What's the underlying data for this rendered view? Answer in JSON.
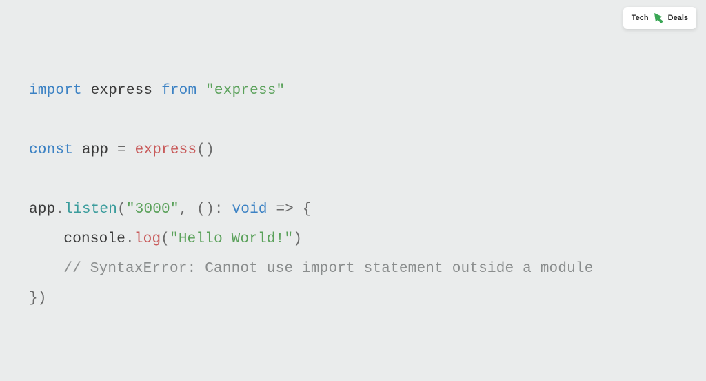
{
  "logo": {
    "text_left": "Tech",
    "text_right": "Deals"
  },
  "code": {
    "l1": {
      "import": "import",
      "express": "express",
      "from": "from",
      "str": "\"express\""
    },
    "l2": {
      "const": "const",
      "app": "app",
      "eq": " = ",
      "express_call": "express",
      "parens": "()"
    },
    "l3": {
      "app": "app",
      "dot1": ".",
      "listen": "listen",
      "open": "(",
      "port": "\"3000\"",
      "comma": ", ",
      "arrow_open": "()",
      "colon": ": ",
      "void": "void",
      "arrow": " => {",
      "close_remainder": ""
    },
    "l4": {
      "console": "console",
      "dot": ".",
      "log": "log",
      "open": "(",
      "str": "\"Hello World!\"",
      "close": ")"
    },
    "l5": {
      "comment": "// SyntaxError: Cannot use import statement outside a module"
    },
    "l6": {
      "close": "})"
    }
  }
}
